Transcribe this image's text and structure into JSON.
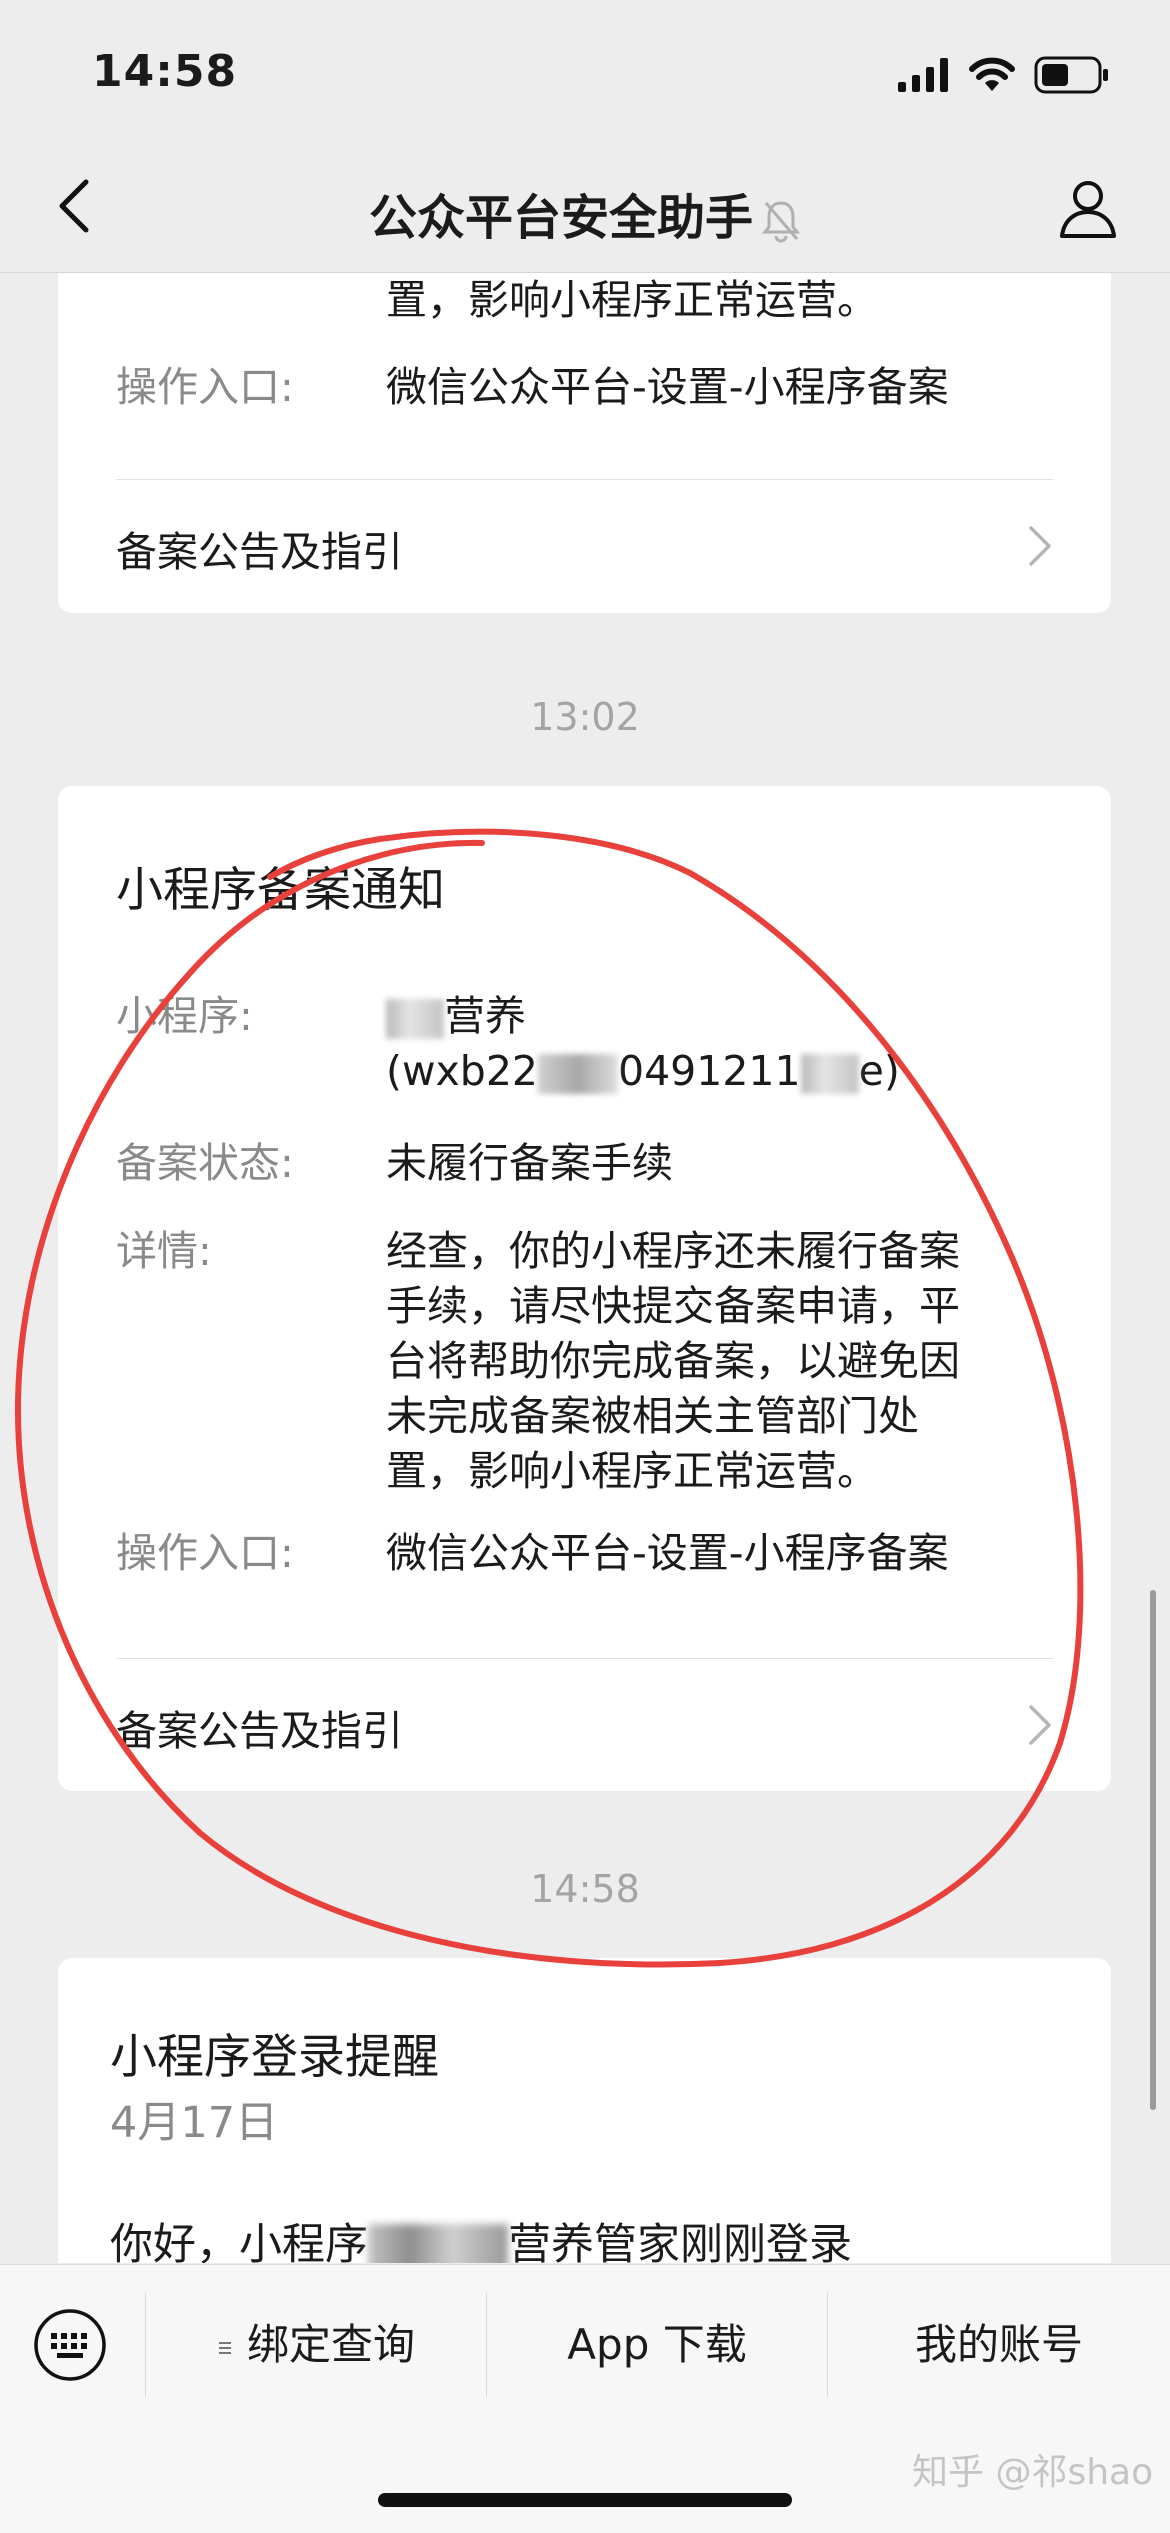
{
  "status_bar": {
    "time": "14:58",
    "icons": [
      "signal-icon",
      "wifi-icon",
      "battery-icon"
    ]
  },
  "nav": {
    "title": "公众平台安全助手",
    "back_icon": "chevron-left-icon",
    "mute_icon": "bell-muted-icon",
    "profile_icon": "person-icon"
  },
  "top_card": {
    "detail_tail": "置，影响小程序正常运营。",
    "entry_label": "操作入口:",
    "entry_value": "微信公众平台-设置-小程序备案",
    "link_label": "备案公告及指引"
  },
  "time_1": "13:02",
  "notice_card": {
    "title": "小程序备案通知",
    "mini_label": "小程序:",
    "mini_name_suffix": "营养",
    "mini_id_prefix": "(wxb22",
    "mini_id_mid": "0491211",
    "mini_id_suffix": "e)",
    "status_label": "备案状态:",
    "status_value": "未履行备案手续",
    "detail_label": "详情:",
    "detail_lines": [
      "经查，你的小程序还未履行备案",
      "手续，请尽快提交备案申请，平",
      "台将帮助你完成备案，以避免因",
      "未完成备案被相关主管部门处",
      "置，影响小程序正常运营。"
    ],
    "entry_label": "操作入口:",
    "entry_value": "微信公众平台-设置-小程序备案",
    "link_label": "备案公告及指引"
  },
  "time_2": "14:58",
  "login_card": {
    "title": "小程序登录提醒",
    "date": "4月17日",
    "body_prefix": "你好，小程序",
    "body_suffix": "营养管家刚刚登录"
  },
  "bottom_menu": {
    "keyboard_icon": "keyboard-icon",
    "items": [
      {
        "label": "绑定查询",
        "icon": "menu-lines-icon"
      },
      {
        "label": "App 下载"
      },
      {
        "label": "我的账号"
      }
    ]
  },
  "watermark": "知乎 @祁shao",
  "colors": {
    "background": "#ededed",
    "card": "#ffffff",
    "annotation": "#e8413c",
    "label": "#8a8a8a"
  }
}
